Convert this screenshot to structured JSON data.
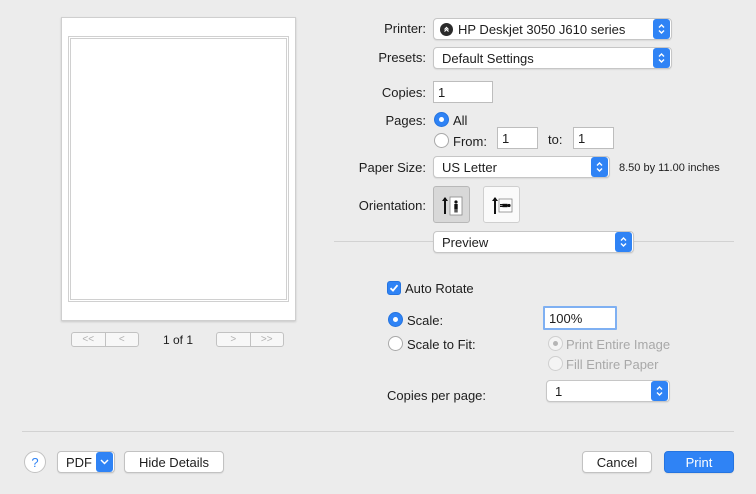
{
  "preview": {
    "page_indicator": "1 of 1",
    "nav_first": "<<",
    "nav_prev": "<",
    "nav_next": ">",
    "nav_last": ">>"
  },
  "printer": {
    "label": "Printer:",
    "value": "HP Deskjet 3050 J610 series"
  },
  "presets": {
    "label": "Presets:",
    "value": "Default Settings"
  },
  "copies": {
    "label": "Copies:",
    "value": "1"
  },
  "pages": {
    "label": "Pages:",
    "all_label": "All",
    "from_label": "From:",
    "from_value": "1",
    "to_label": "to:",
    "to_value": "1",
    "selected": "All"
  },
  "paper_size": {
    "label": "Paper Size:",
    "value": "US Letter",
    "dimensions": "8.50 by 11.00 inches"
  },
  "orientation": {
    "label": "Orientation:",
    "selected": "portrait",
    "options": [
      "portrait",
      "landscape"
    ]
  },
  "section_menu": {
    "value": "Preview"
  },
  "auto_rotate": {
    "label": "Auto Rotate",
    "checked": true
  },
  "scale": {
    "label": "Scale:",
    "value": "100%",
    "selected": true
  },
  "scale_to_fit": {
    "label": "Scale to Fit:",
    "selected": false,
    "option_print_entire": "Print Entire Image",
    "option_fill_paper": "Fill Entire Paper"
  },
  "copies_per_page": {
    "label": "Copies per page:",
    "value": "1"
  },
  "footer": {
    "help_label": "?",
    "pdf_label": "PDF",
    "hide_details_label": "Hide Details",
    "cancel_label": "Cancel",
    "print_label": "Print"
  },
  "colors": {
    "accent": "#2f83f5",
    "background": "#ececec"
  },
  "icons": {
    "printer_status": "printer-status-icon",
    "popup_arrows": "updown-arrows-icon",
    "dropdown": "chevron-down-icon",
    "portrait": "portrait-orientation-icon",
    "landscape": "landscape-orientation-icon",
    "checkmark": "checkmark-icon"
  }
}
